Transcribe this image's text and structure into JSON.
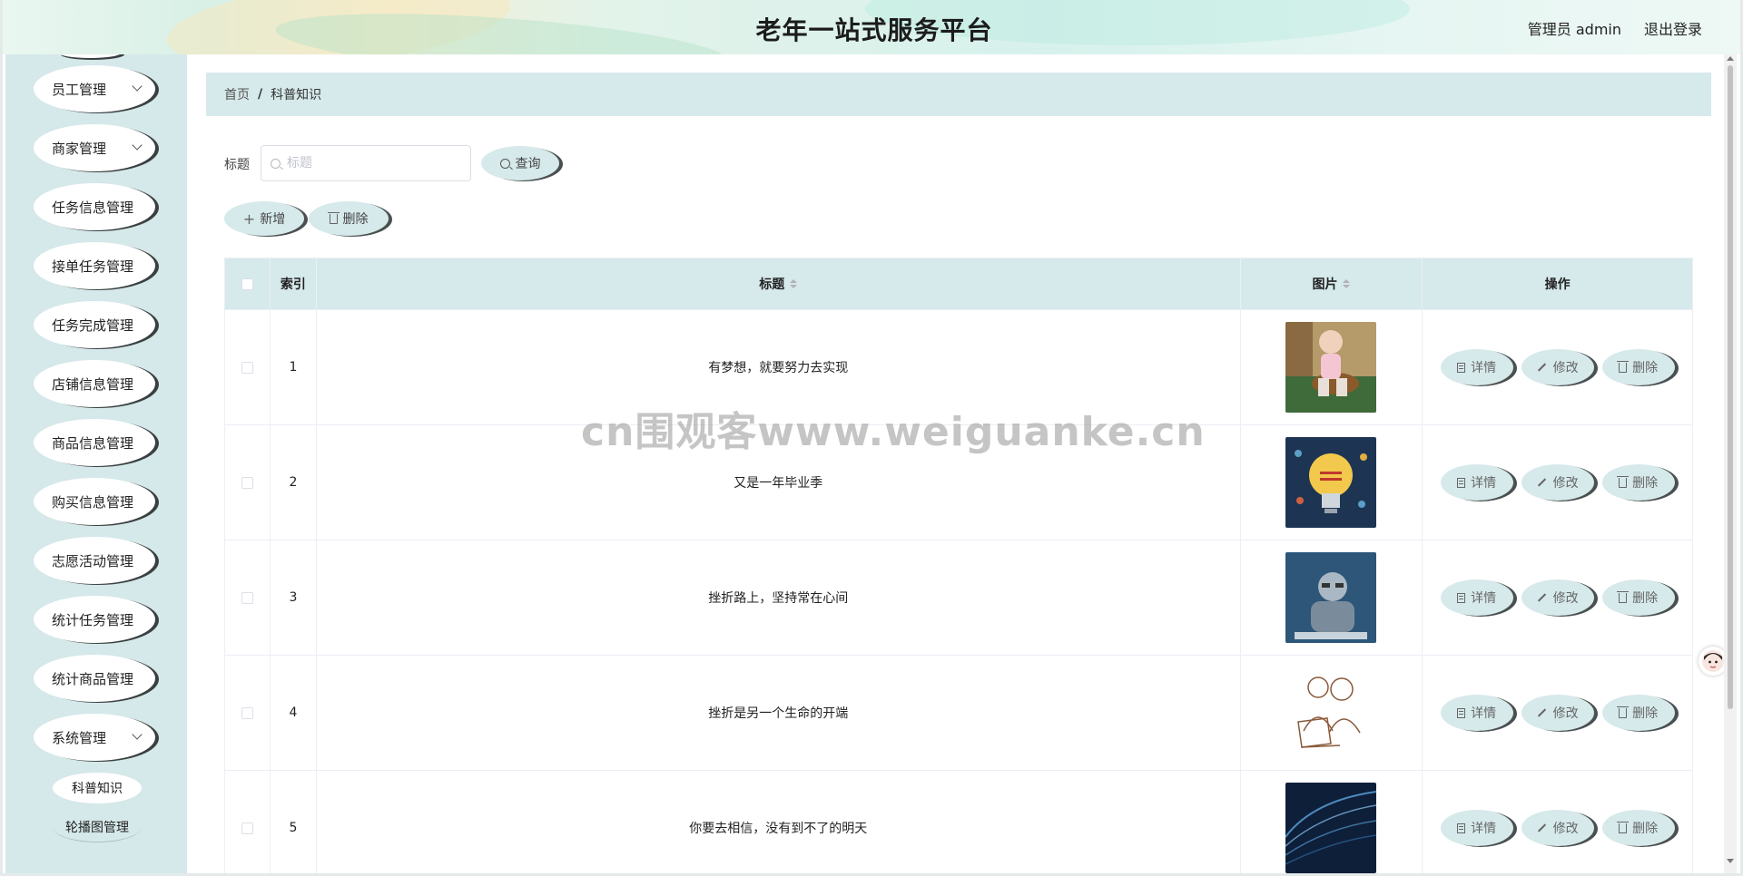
{
  "header": {
    "title": "老年一站式服务平台",
    "user": "管理员 admin",
    "logout": "退出登录"
  },
  "sidebar": {
    "items": [
      {
        "label": "员工管理",
        "chevron": true
      },
      {
        "label": "商家管理",
        "chevron": true
      },
      {
        "label": "任务信息管理",
        "chevron": false
      },
      {
        "label": "接单任务管理",
        "chevron": false
      },
      {
        "label": "任务完成管理",
        "chevron": false
      },
      {
        "label": "店铺信息管理",
        "chevron": false
      },
      {
        "label": "商品信息管理",
        "chevron": false
      },
      {
        "label": "购买信息管理",
        "chevron": false
      },
      {
        "label": "志愿活动管理",
        "chevron": false
      },
      {
        "label": "统计任务管理",
        "chevron": false
      },
      {
        "label": "统计商品管理",
        "chevron": false
      },
      {
        "label": "系统管理",
        "chevron": true
      }
    ],
    "subitems": [
      {
        "label": "科普知识"
      },
      {
        "label": "轮播图管理"
      }
    ]
  },
  "breadcrumb": {
    "home": "首页",
    "separator": "/",
    "current": "科普知识"
  },
  "search": {
    "label": "标题",
    "placeholder": "标题",
    "value": "",
    "button": "查询"
  },
  "toolbar": {
    "add": "新增",
    "delete": "删除"
  },
  "table": {
    "columns": {
      "index": "索引",
      "title": "标题",
      "image": "图片",
      "ops": "操作"
    },
    "ops": {
      "detail": "详情",
      "edit": "修改",
      "delete": "删除"
    },
    "rows": [
      {
        "index": "1",
        "title": "有梦想，就要努力去实现",
        "image": "baby-guitar-photo"
      },
      {
        "index": "2",
        "title": "又是一年毕业季",
        "image": "lightbulb-infographic"
      },
      {
        "index": "3",
        "title": "挫折路上，坚持常在心间",
        "image": "man-code-screen-photo"
      },
      {
        "index": "4",
        "title": "挫折是另一个生命的开端",
        "image": "sketch-two-people-laptop"
      },
      {
        "index": "5",
        "title": "你要去相信，没有到不了的明天",
        "image": "code-wave-photo"
      }
    ]
  },
  "watermark": "cn围观客www.weiguanke.cn",
  "colors": {
    "accent": "#d6e9eb",
    "sidebar": "#d5e8ea",
    "shadow": "#4a5050"
  }
}
